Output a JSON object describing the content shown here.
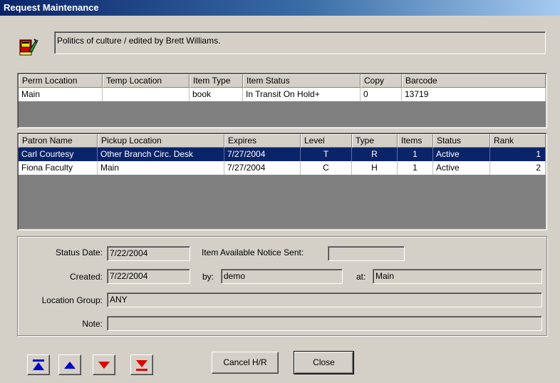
{
  "window": {
    "title": "Request Maintenance"
  },
  "record": {
    "title": "Politics of culture / edited by Brett Williams."
  },
  "item_table": {
    "columns": [
      "Perm Location",
      "Temp Location",
      "Item Type",
      "Item Status",
      "Copy",
      "Barcode"
    ],
    "rows": [
      [
        "Main",
        "",
        "book",
        "In Transit On Hold+",
        "0",
        "13719"
      ]
    ]
  },
  "hold_table": {
    "columns": [
      "Patron Name",
      "Pickup Location",
      "Expires",
      "Level",
      "Type",
      "Items",
      "Status",
      "Rank"
    ],
    "rows": [
      [
        "Carl Courtesy",
        "Other Branch Circ. Desk",
        "7/27/2004",
        "T",
        "R",
        "1",
        "Active",
        "1"
      ],
      [
        "Fiona Faculty",
        "Main",
        "7/27/2004",
        "C",
        "H",
        "1",
        "Active",
        "2"
      ]
    ],
    "selected_row": 0
  },
  "details": {
    "status_date_label": "Status Date:",
    "status_date": "7/22/2004",
    "notice_label": "Item Available Notice Sent:",
    "notice_value": "",
    "created_label": "Created:",
    "created": "7/22/2004",
    "by_label": "by:",
    "by": "demo",
    "at_label": "at:",
    "at": "Main",
    "location_group_label": "Location Group:",
    "location_group": "ANY",
    "note_label": "Note:",
    "note": ""
  },
  "buttons": {
    "cancel_label": "Cancel H/R",
    "close_label": "Close"
  },
  "icons": {
    "record_icon": "book-wrench-icon",
    "nav": [
      "move-to-top-icon",
      "move-up-icon",
      "move-down-icon",
      "move-to-bottom-icon"
    ]
  },
  "colors": {
    "selection": "#0a246a",
    "nav_blue": "#0000cc",
    "nav_red": "#e00000"
  }
}
